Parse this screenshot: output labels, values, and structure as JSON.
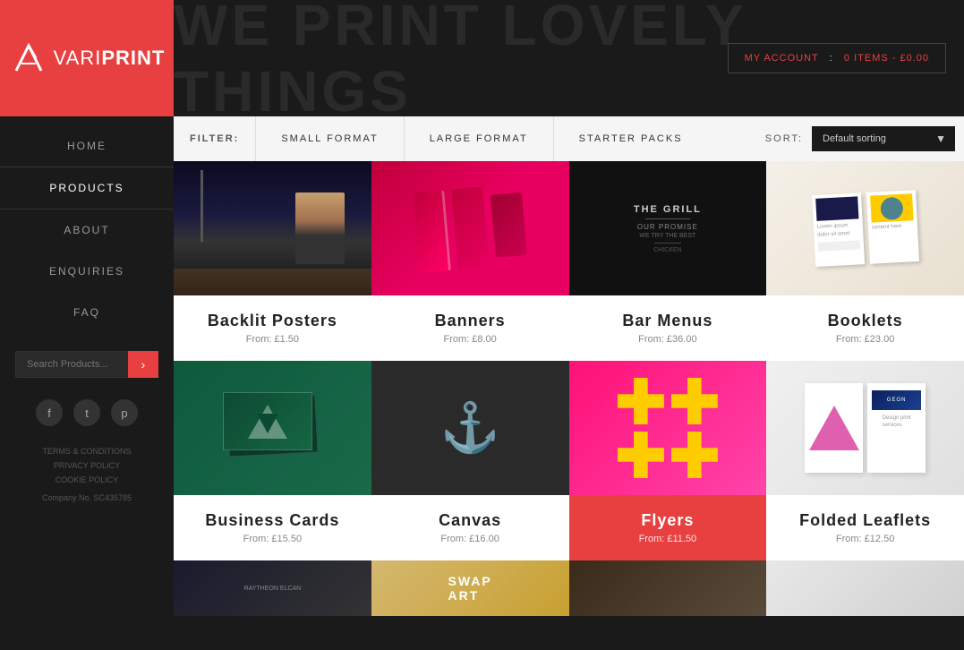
{
  "logo": {
    "text_vari": "VARI",
    "text_print": "PRINT"
  },
  "account": {
    "label": "MY ACCOUNT",
    "items_label": "0 ITEMS - £0.00"
  },
  "header": {
    "title": "WE PRINT LOVELY THINGS"
  },
  "sidebar_nav": {
    "items": [
      {
        "id": "home",
        "label": "HOME"
      },
      {
        "id": "products",
        "label": "PRODUCTS"
      },
      {
        "id": "about",
        "label": "ABOUT"
      },
      {
        "id": "enquiries",
        "label": "ENQUIRIES"
      },
      {
        "id": "faq",
        "label": "FAQ"
      }
    ]
  },
  "search": {
    "placeholder": "Search Products..."
  },
  "social": {
    "facebook": "f",
    "twitter": "t",
    "pinterest": "p"
  },
  "footer_links": {
    "terms": "TERMS & CONDITIONS",
    "privacy": "PRIVACY POLICY",
    "cookie": "COOKIE POLICY",
    "company": "Company No. SC435785"
  },
  "filter_bar": {
    "filter_label": "FILTER:",
    "small_format": "SMALL FORMAT",
    "large_format": "LARGE FORMAT",
    "starter_packs": "STARTER PACKS",
    "sort_label": "SORT:",
    "sort_default": "Default sorting"
  },
  "products": [
    {
      "id": "backlit-posters",
      "name": "Backlit Posters",
      "price": "From: £1.50",
      "featured": false
    },
    {
      "id": "banners",
      "name": "Banners",
      "price": "From: £8.00",
      "featured": false
    },
    {
      "id": "bar-menus",
      "name": "Bar Menus",
      "price": "From: £36.00",
      "featured": false
    },
    {
      "id": "booklets",
      "name": "Booklets",
      "price": "From: £23.00",
      "featured": false
    },
    {
      "id": "business-cards",
      "name": "Business Cards",
      "price": "From: £15.50",
      "featured": false
    },
    {
      "id": "canvas",
      "name": "Canvas",
      "price": "From: £16.00",
      "featured": false
    },
    {
      "id": "flyers",
      "name": "Flyers",
      "price": "From: £11.50",
      "featured": true
    },
    {
      "id": "folded-leaflets",
      "name": "Folded Leaflets",
      "price": "From: £12.50",
      "featured": false
    }
  ]
}
